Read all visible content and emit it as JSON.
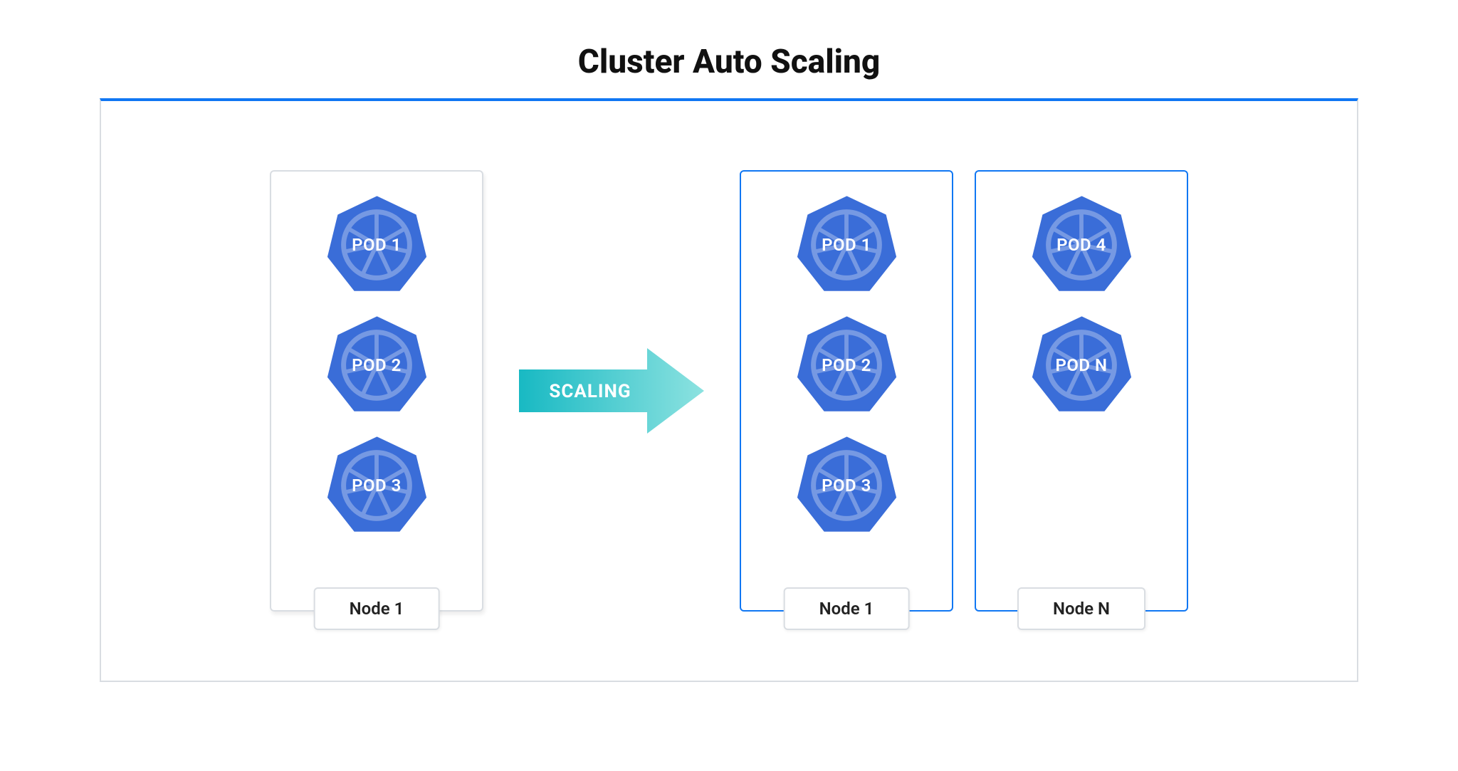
{
  "title": "Cluster Auto Scaling",
  "arrow_label": "SCALING",
  "left_node": {
    "label": "Node 1",
    "pods": [
      "POD 1",
      "POD 2",
      "POD 3"
    ]
  },
  "right_nodes": [
    {
      "label": "Node 1",
      "pods": [
        "POD 1",
        "POD 2",
        "POD 3"
      ]
    },
    {
      "label": "Node N",
      "pods": [
        "POD 4",
        "POD N"
      ]
    }
  ],
  "colors": {
    "pod_fill": "#3a6dd8",
    "accent": "#1077f3",
    "arrow_gradient_start": "#18b9c3",
    "arrow_gradient_end": "#8ce2e0"
  }
}
